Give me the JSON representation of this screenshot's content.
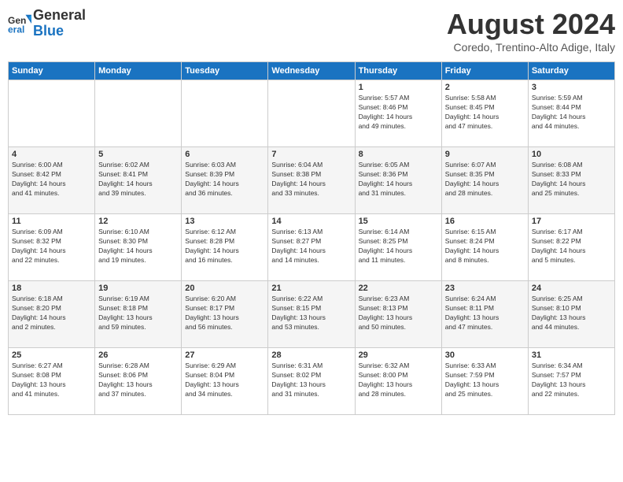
{
  "header": {
    "logo_line1": "General",
    "logo_line2": "Blue",
    "month_year": "August 2024",
    "location": "Coredo, Trentino-Alto Adige, Italy"
  },
  "weekdays": [
    "Sunday",
    "Monday",
    "Tuesday",
    "Wednesday",
    "Thursday",
    "Friday",
    "Saturday"
  ],
  "weeks": [
    [
      {
        "day": "",
        "info": ""
      },
      {
        "day": "",
        "info": ""
      },
      {
        "day": "",
        "info": ""
      },
      {
        "day": "",
        "info": ""
      },
      {
        "day": "1",
        "info": "Sunrise: 5:57 AM\nSunset: 8:46 PM\nDaylight: 14 hours\nand 49 minutes."
      },
      {
        "day": "2",
        "info": "Sunrise: 5:58 AM\nSunset: 8:45 PM\nDaylight: 14 hours\nand 47 minutes."
      },
      {
        "day": "3",
        "info": "Sunrise: 5:59 AM\nSunset: 8:44 PM\nDaylight: 14 hours\nand 44 minutes."
      }
    ],
    [
      {
        "day": "4",
        "info": "Sunrise: 6:00 AM\nSunset: 8:42 PM\nDaylight: 14 hours\nand 41 minutes."
      },
      {
        "day": "5",
        "info": "Sunrise: 6:02 AM\nSunset: 8:41 PM\nDaylight: 14 hours\nand 39 minutes."
      },
      {
        "day": "6",
        "info": "Sunrise: 6:03 AM\nSunset: 8:39 PM\nDaylight: 14 hours\nand 36 minutes."
      },
      {
        "day": "7",
        "info": "Sunrise: 6:04 AM\nSunset: 8:38 PM\nDaylight: 14 hours\nand 33 minutes."
      },
      {
        "day": "8",
        "info": "Sunrise: 6:05 AM\nSunset: 8:36 PM\nDaylight: 14 hours\nand 31 minutes."
      },
      {
        "day": "9",
        "info": "Sunrise: 6:07 AM\nSunset: 8:35 PM\nDaylight: 14 hours\nand 28 minutes."
      },
      {
        "day": "10",
        "info": "Sunrise: 6:08 AM\nSunset: 8:33 PM\nDaylight: 14 hours\nand 25 minutes."
      }
    ],
    [
      {
        "day": "11",
        "info": "Sunrise: 6:09 AM\nSunset: 8:32 PM\nDaylight: 14 hours\nand 22 minutes."
      },
      {
        "day": "12",
        "info": "Sunrise: 6:10 AM\nSunset: 8:30 PM\nDaylight: 14 hours\nand 19 minutes."
      },
      {
        "day": "13",
        "info": "Sunrise: 6:12 AM\nSunset: 8:28 PM\nDaylight: 14 hours\nand 16 minutes."
      },
      {
        "day": "14",
        "info": "Sunrise: 6:13 AM\nSunset: 8:27 PM\nDaylight: 14 hours\nand 14 minutes."
      },
      {
        "day": "15",
        "info": "Sunrise: 6:14 AM\nSunset: 8:25 PM\nDaylight: 14 hours\nand 11 minutes."
      },
      {
        "day": "16",
        "info": "Sunrise: 6:15 AM\nSunset: 8:24 PM\nDaylight: 14 hours\nand 8 minutes."
      },
      {
        "day": "17",
        "info": "Sunrise: 6:17 AM\nSunset: 8:22 PM\nDaylight: 14 hours\nand 5 minutes."
      }
    ],
    [
      {
        "day": "18",
        "info": "Sunrise: 6:18 AM\nSunset: 8:20 PM\nDaylight: 14 hours\nand 2 minutes."
      },
      {
        "day": "19",
        "info": "Sunrise: 6:19 AM\nSunset: 8:18 PM\nDaylight: 13 hours\nand 59 minutes."
      },
      {
        "day": "20",
        "info": "Sunrise: 6:20 AM\nSunset: 8:17 PM\nDaylight: 13 hours\nand 56 minutes."
      },
      {
        "day": "21",
        "info": "Sunrise: 6:22 AM\nSunset: 8:15 PM\nDaylight: 13 hours\nand 53 minutes."
      },
      {
        "day": "22",
        "info": "Sunrise: 6:23 AM\nSunset: 8:13 PM\nDaylight: 13 hours\nand 50 minutes."
      },
      {
        "day": "23",
        "info": "Sunrise: 6:24 AM\nSunset: 8:11 PM\nDaylight: 13 hours\nand 47 minutes."
      },
      {
        "day": "24",
        "info": "Sunrise: 6:25 AM\nSunset: 8:10 PM\nDaylight: 13 hours\nand 44 minutes."
      }
    ],
    [
      {
        "day": "25",
        "info": "Sunrise: 6:27 AM\nSunset: 8:08 PM\nDaylight: 13 hours\nand 41 minutes."
      },
      {
        "day": "26",
        "info": "Sunrise: 6:28 AM\nSunset: 8:06 PM\nDaylight: 13 hours\nand 37 minutes."
      },
      {
        "day": "27",
        "info": "Sunrise: 6:29 AM\nSunset: 8:04 PM\nDaylight: 13 hours\nand 34 minutes."
      },
      {
        "day": "28",
        "info": "Sunrise: 6:31 AM\nSunset: 8:02 PM\nDaylight: 13 hours\nand 31 minutes."
      },
      {
        "day": "29",
        "info": "Sunrise: 6:32 AM\nSunset: 8:00 PM\nDaylight: 13 hours\nand 28 minutes."
      },
      {
        "day": "30",
        "info": "Sunrise: 6:33 AM\nSunset: 7:59 PM\nDaylight: 13 hours\nand 25 minutes."
      },
      {
        "day": "31",
        "info": "Sunrise: 6:34 AM\nSunset: 7:57 PM\nDaylight: 13 hours\nand 22 minutes."
      }
    ]
  ]
}
